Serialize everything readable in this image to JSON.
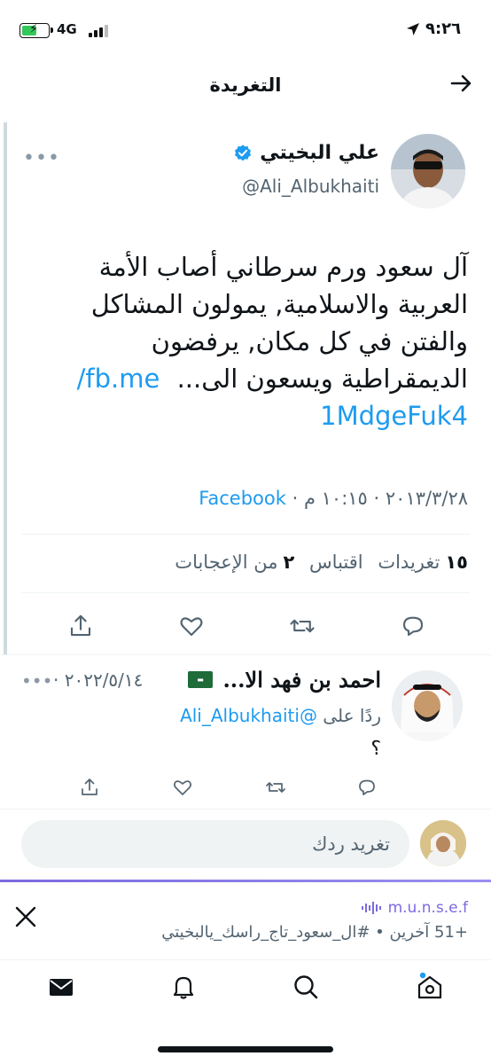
{
  "status_bar": {
    "time": "٩:٢٦",
    "network": "4G"
  },
  "header": {
    "title": "التغريدة"
  },
  "tweet": {
    "display_name": "علي البخيتي",
    "handle": "@Ali_Albukhaiti",
    "text_lines": [
      "آل سعود ورم سرطاني أصاب الأمة",
      "العربية والاسلامية, يمولون المشاكل",
      "والفتن في كل مكان, يرفضون",
      "الديمقراطية ويسعون الى...",
      "1MdgeFuk4"
    ],
    "link_part": "fb.me/",
    "date": "٢٠١٣/٣/٢٨",
    "time": "١٠:١٥ م",
    "source": "Facebook",
    "retweets_count": "١٥",
    "retweets_label": "تغريدات",
    "quotes_label": "اقتباس",
    "likes_count": "٢",
    "likes_label": "من الإعجابات"
  },
  "reply": {
    "display_name": "احمد بن فهد الا...",
    "date": "٢٠٢٢/٥/١٤",
    "replying_prefix": "ردًا على",
    "replying_to": "@Ali_Albukhaiti",
    "text": "؟"
  },
  "composer": {
    "placeholder": "تغريد ردك"
  },
  "space": {
    "host": "m.u.n.s.e.f",
    "desc": "+51 آخرين • #ال_سعود_تاج_راسك_يالبخيتي"
  },
  "colors": {
    "accent": "#1d9bf0",
    "space_accent": "#7b6ae0",
    "secondary_text": "#536471"
  },
  "icons": [
    "share-icon",
    "like-icon",
    "retweet-icon",
    "reply-icon",
    "mail-icon",
    "bell-icon",
    "search-icon",
    "home-icon"
  ]
}
